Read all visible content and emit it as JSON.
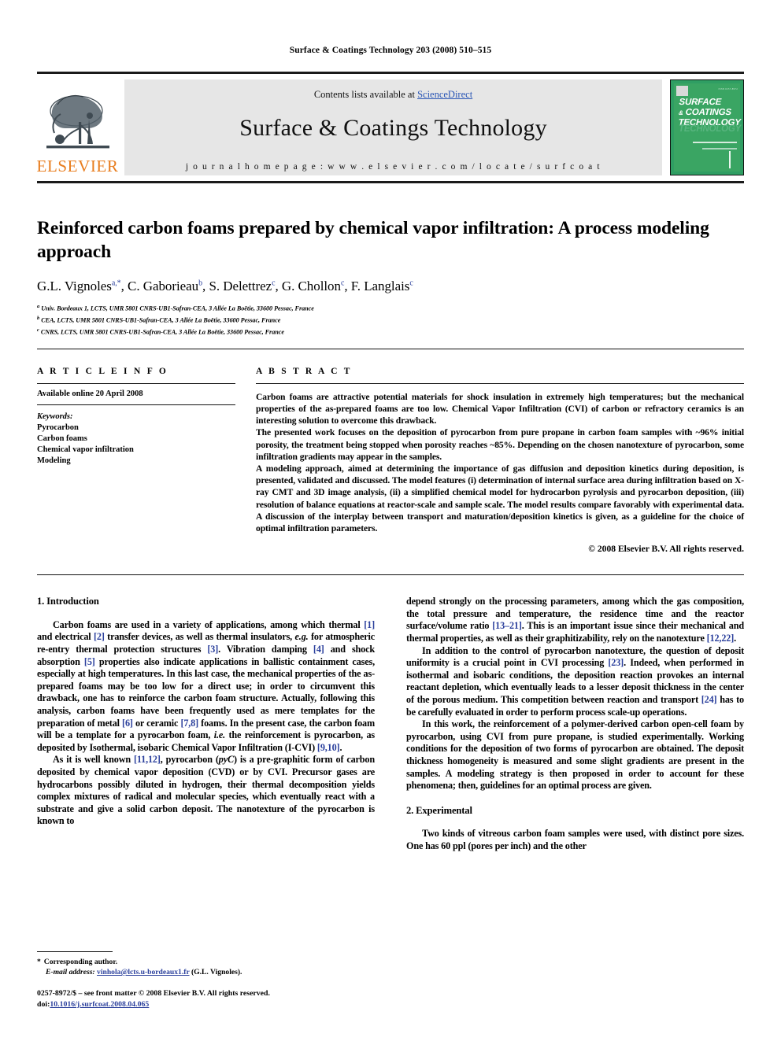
{
  "running_head": "Surface & Coatings Technology 203 (2008) 510–515",
  "masthead": {
    "contents_prefix": "Contents lists available at ",
    "sciencedirect": "ScienceDirect",
    "journal_title": "Surface & Coatings Technology",
    "homepage": "j o u r n a l   h o m e p a g e :   w w w . e l s e v i e r . c o m / l o c a t e / s u r f c o a t",
    "elsevier_wordmark": "ELSEVIER",
    "cover": {
      "line1": "SURFACE",
      "amp": "&",
      "line2": "COATINGS",
      "line3": "TECHNOLOGY",
      "ghost": "TECHNOLOGY",
      "tiny": "ISSN 0257-8972"
    },
    "accent_color": "#2a56b5",
    "elsevier_orange": "#E87D1E",
    "cover_green": "#3aa563"
  },
  "article": {
    "title": "Reinforced carbon foams prepared by chemical vapor infiltration: A process modeling approach",
    "authors": [
      {
        "name": "G.L. Vignoles",
        "sup": "a,*"
      },
      {
        "name": "C. Gaborieau",
        "sup": "b"
      },
      {
        "name": "S. Delettrez",
        "sup": "c"
      },
      {
        "name": "G. Chollon",
        "sup": "c"
      },
      {
        "name": "F. Langlais",
        "sup": "c"
      }
    ],
    "affiliations": [
      {
        "label": "a",
        "text": "Univ. Bordeaux 1, LCTS, UMR 5801 CNRS-UB1-Safran-CEA, 3 Allée La Boëtie, 33600 Pessac, France"
      },
      {
        "label": "b",
        "text": "CEA, LCTS, UMR 5801 CNRS-UB1-Safran-CEA, 3 Allée La Boëtie, 33600 Pessac, France"
      },
      {
        "label": "c",
        "text": "CNRS, LCTS, UMR 5801 CNRS-UB1-Safran-CEA, 3 Allée La Boëtie, 33600 Pessac, France"
      }
    ]
  },
  "article_info": {
    "label": "A R T I C L E    I N F O",
    "history": "Available online 20 April 2008",
    "keywords_head": "Keywords:",
    "keywords": [
      "Pyrocarbon",
      "Carbon foams",
      "Chemical vapor infiltration",
      "Modeling"
    ]
  },
  "abstract": {
    "label": "A B S T R A C T",
    "paragraphs": [
      "Carbon foams are attractive potential materials for shock insulation in extremely high temperatures; but the mechanical properties of the as-prepared foams are too low. Chemical Vapor Infiltration (CVI) of carbon or refractory ceramics is an interesting solution to overcome this drawback.",
      "The presented work focuses on the deposition of pyrocarbon from pure propane in carbon foam samples with ~96% initial porosity, the treatment being stopped when porosity reaches ~85%. Depending on the chosen nanotexture of pyrocarbon, some infiltration gradients may appear in the samples.",
      "A modeling approach, aimed at determining the importance of gas diffusion and deposition kinetics during deposition, is presented, validated and discussed. The model features (i) determination of internal surface area during infiltration based on X-ray CMT and 3D image analysis, (ii) a simplified chemical model for hydrocarbon pyrolysis and pyrocarbon deposition, (iii) resolution of balance equations at reactor-scale and sample scale. The model results compare favorably with experimental data. A discussion of the interplay between transport and maturation/deposition kinetics is given, as a guideline for the choice of optimal infiltration parameters."
    ],
    "copyright": "© 2008 Elsevier B.V. All rights reserved."
  },
  "sections": {
    "introduction_heading": "1. Introduction",
    "experimental_heading": "2. Experimental"
  },
  "footnote": {
    "corresponding": "Corresponding author.",
    "email_label": "E-mail address:",
    "email": "vinhola@lcts.u-bordeaux1.fr",
    "email_owner": "(G.L. Vignoles).",
    "issn_line": "0257-8972/$ – see front matter © 2008 Elsevier B.V. All rights reserved.",
    "doi_label": "doi:",
    "doi": "10.1016/j.surfcoat.2008.04.065"
  }
}
